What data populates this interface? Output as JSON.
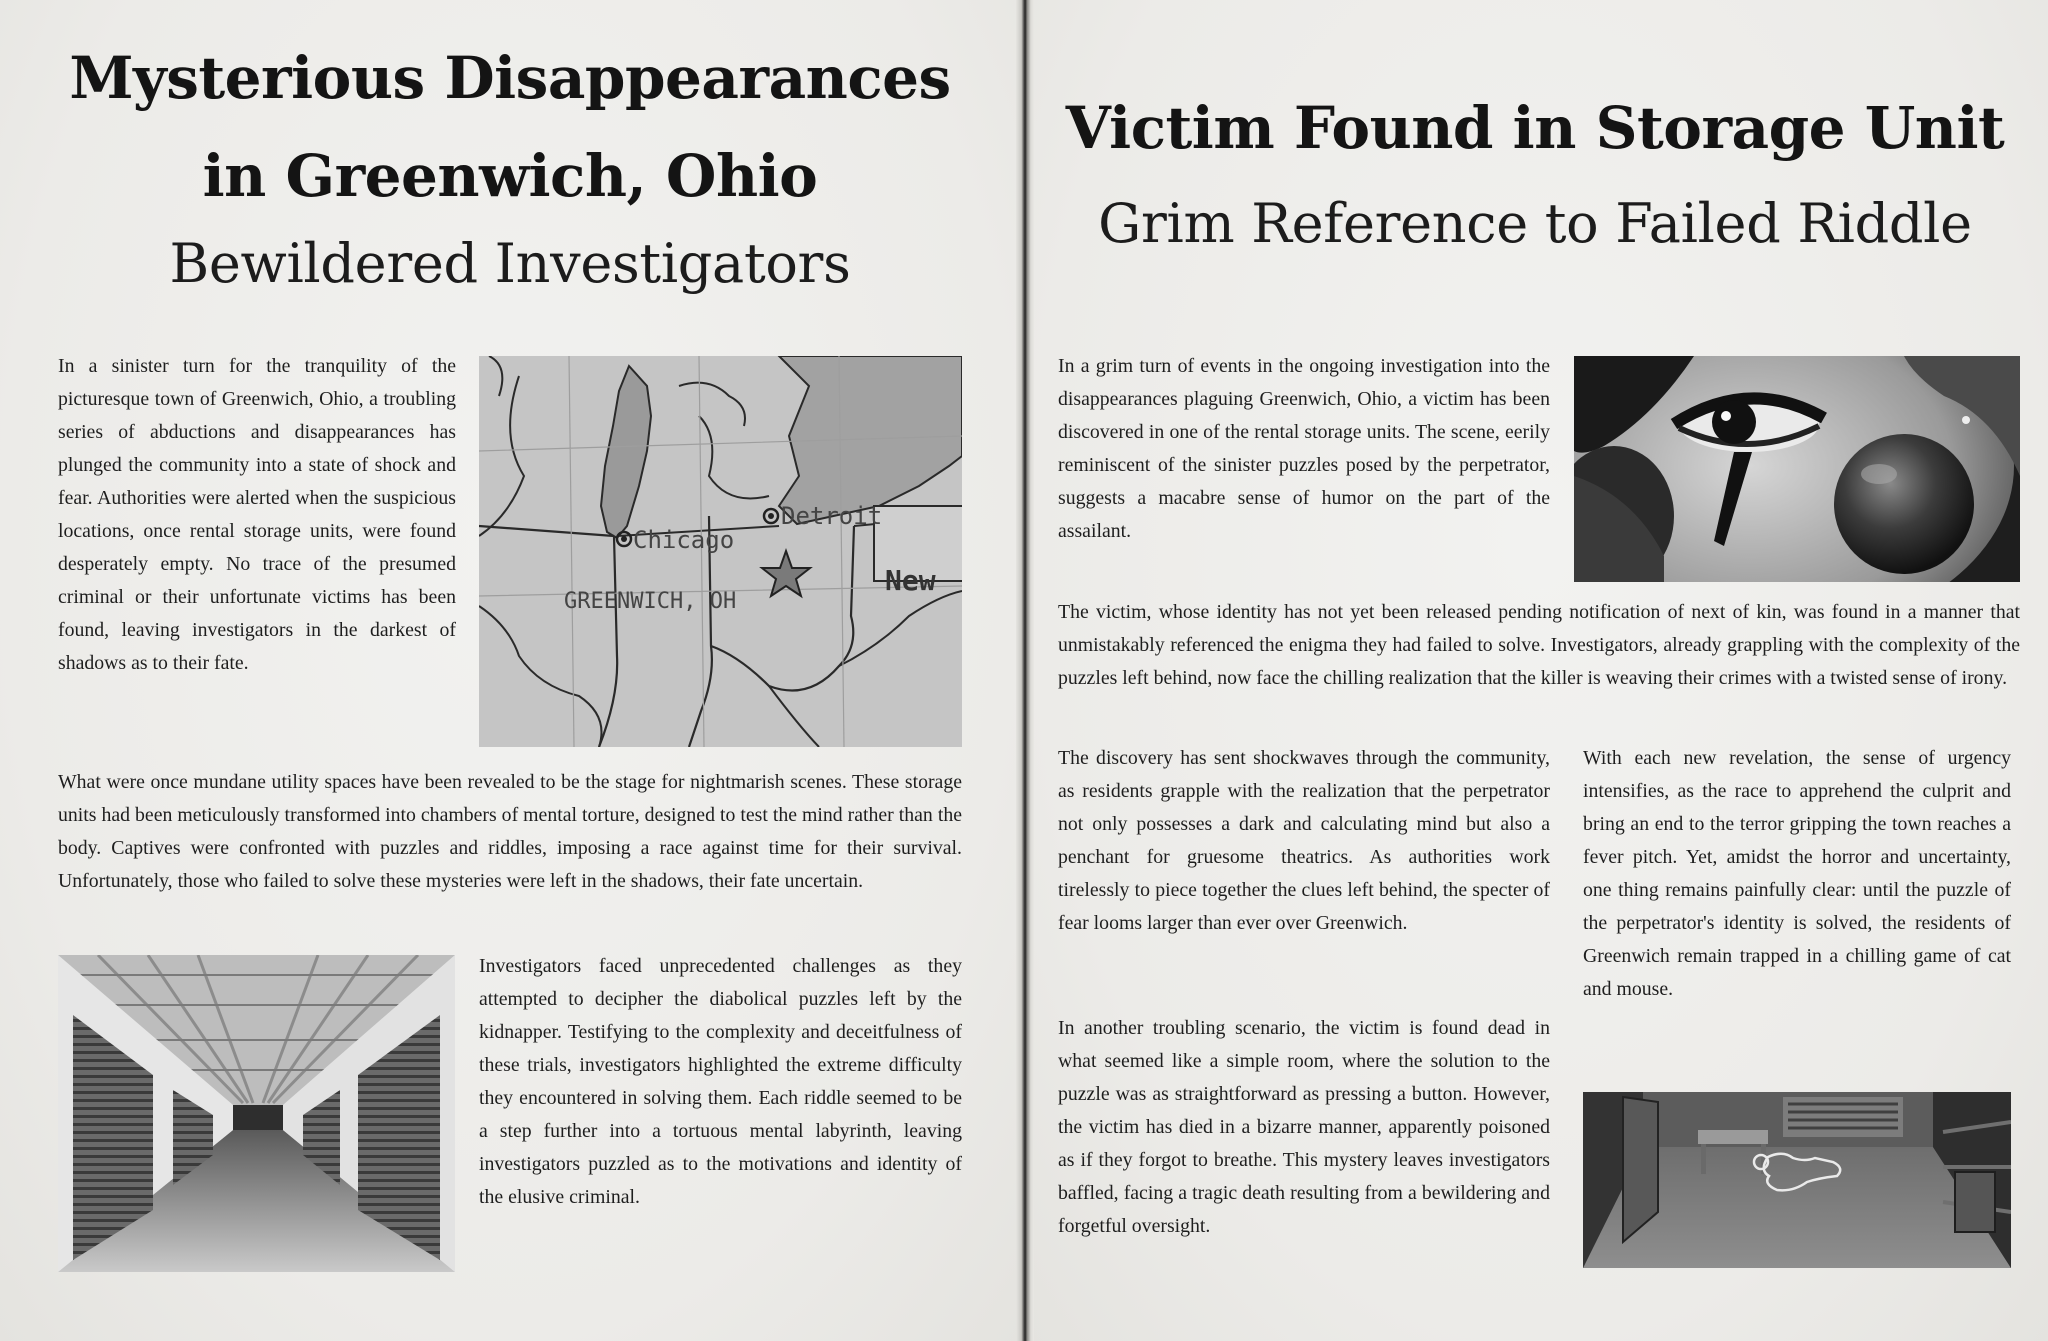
{
  "left": {
    "headline_line1": "Mysterious Disappearances",
    "headline_line2": "in Greenwich, Ohio",
    "subheadline": "Bewildered Investigators",
    "paragraph1": "In a sinister turn for the tranquility of the picturesque town of Greenwich, Ohio, a troubling series of abductions and disappearances has plunged the community into a state of shock and fear. Authorities were alerted when the suspicious locations, once rental storage units, were found desperately empty. No trace of the presumed criminal or their unfortunate victims has been found, leaving investigators in the darkest of shadows as to their fate.",
    "paragraph2": "What were once mundane utility spaces have been revealed to be the stage for nightmarish scenes. These storage units had been meticulously transformed into chambers of mental torture, designed to test the mind rather than the body. Captives were confronted with puzzles and riddles, imposing a race against time for their survival. Unfortunately, those who failed to solve these mysteries were left in the shadows, their fate uncertain.",
    "paragraph3": "Investigators faced unprecedented challenges as they attempted to decipher the diabolical puzzles left by the kidnapper. Testifying to the complexity and deceitfulness of these trials, investigators highlighted the extreme difficulty they encountered in solving them. Each riddle seemed to be a step further into a tortuous mental labyrinth, leaving investigators puzzled as to the motivations and identity of the elusive criminal.",
    "map": {
      "label_detroit": "Detroit",
      "label_chicago": "Chicago",
      "label_greenwich": "GREENWICH, OH",
      "label_new": "New"
    }
  },
  "right": {
    "headline": "Victim Found in Storage Unit",
    "subheadline": "Grim Reference to Failed Riddle",
    "paragraph1": "In a grim turn of events in the ongoing investigation into the disappearances plaguing Greenwich, Ohio, a victim has been discovered in one of the rental storage units. The scene, eerily reminiscent of the sinister puzzles posed by the perpetrator, suggests a macabre sense of humor on the part of the assailant.",
    "paragraph2": "The victim, whose identity has not yet been released pending notification of next of kin, was found in a manner that unmistakably referenced the enigma they had failed to solve. Investigators, already grappling with the complexity of the puzzles left behind, now face the chilling realization that the killer is weaving their crimes with a twisted sense of irony.",
    "paragraph3": "The discovery has sent shockwaves through the community, as residents grapple with the realization that the perpetrator not only possesses a dark and calculating mind but also a penchant for gruesome theatrics. As authorities work tirelessly to piece together the clues left behind, the specter of fear looms larger than ever over Greenwich.",
    "paragraph4": "In another troubling scenario, the victim is found dead in what seemed like a simple room, where the solution to the puzzle was as straightforward as pressing a button. However, the victim has died in a bizarre manner, apparently poisoned as if they forgot to breathe. This mystery leaves investigators baffled, facing a tragic death resulting from a bewildering and forgetful oversight.",
    "paragraph5": "With each new revelation, the sense of urgency intensifies, as the race to apprehend the culprit and bring an end to the terror gripping the town reaches a fever pitch. Yet, amidst the horror and uncertainty, one thing remains painfully clear: until the puzzle of the perpetrator's identity is solved, the residents of Greenwich remain trapped in a chilling game of cat and mouse."
  }
}
